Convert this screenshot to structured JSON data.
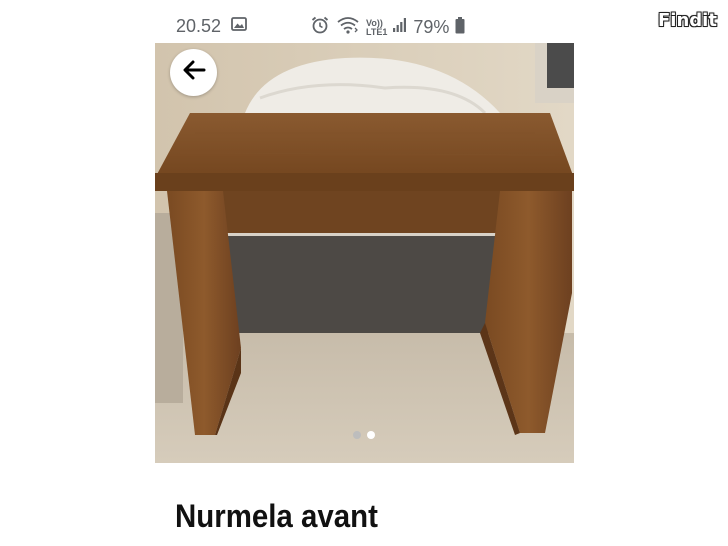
{
  "status_bar": {
    "time": "20.52",
    "network_label_top": "Vo))",
    "network_label_bottom": "LTE1",
    "battery_percent": "79%"
  },
  "watermark": {
    "text": "Findit"
  },
  "gallery": {
    "total_images": 2,
    "active_index": 1,
    "dot_active_color": "#ffffff",
    "dot_inactive_color": "#bdbdbd"
  },
  "listing": {
    "title": "Nurmela avant"
  },
  "icons": {
    "status_left": [
      "image-icon"
    ],
    "status_right": [
      "alarm-icon",
      "wifi-icon",
      "signal-icon",
      "battery-icon"
    ],
    "navigation": [
      "arrow-left-icon"
    ]
  },
  "colors": {
    "status_text": "#5f6368",
    "title": "#111111"
  }
}
